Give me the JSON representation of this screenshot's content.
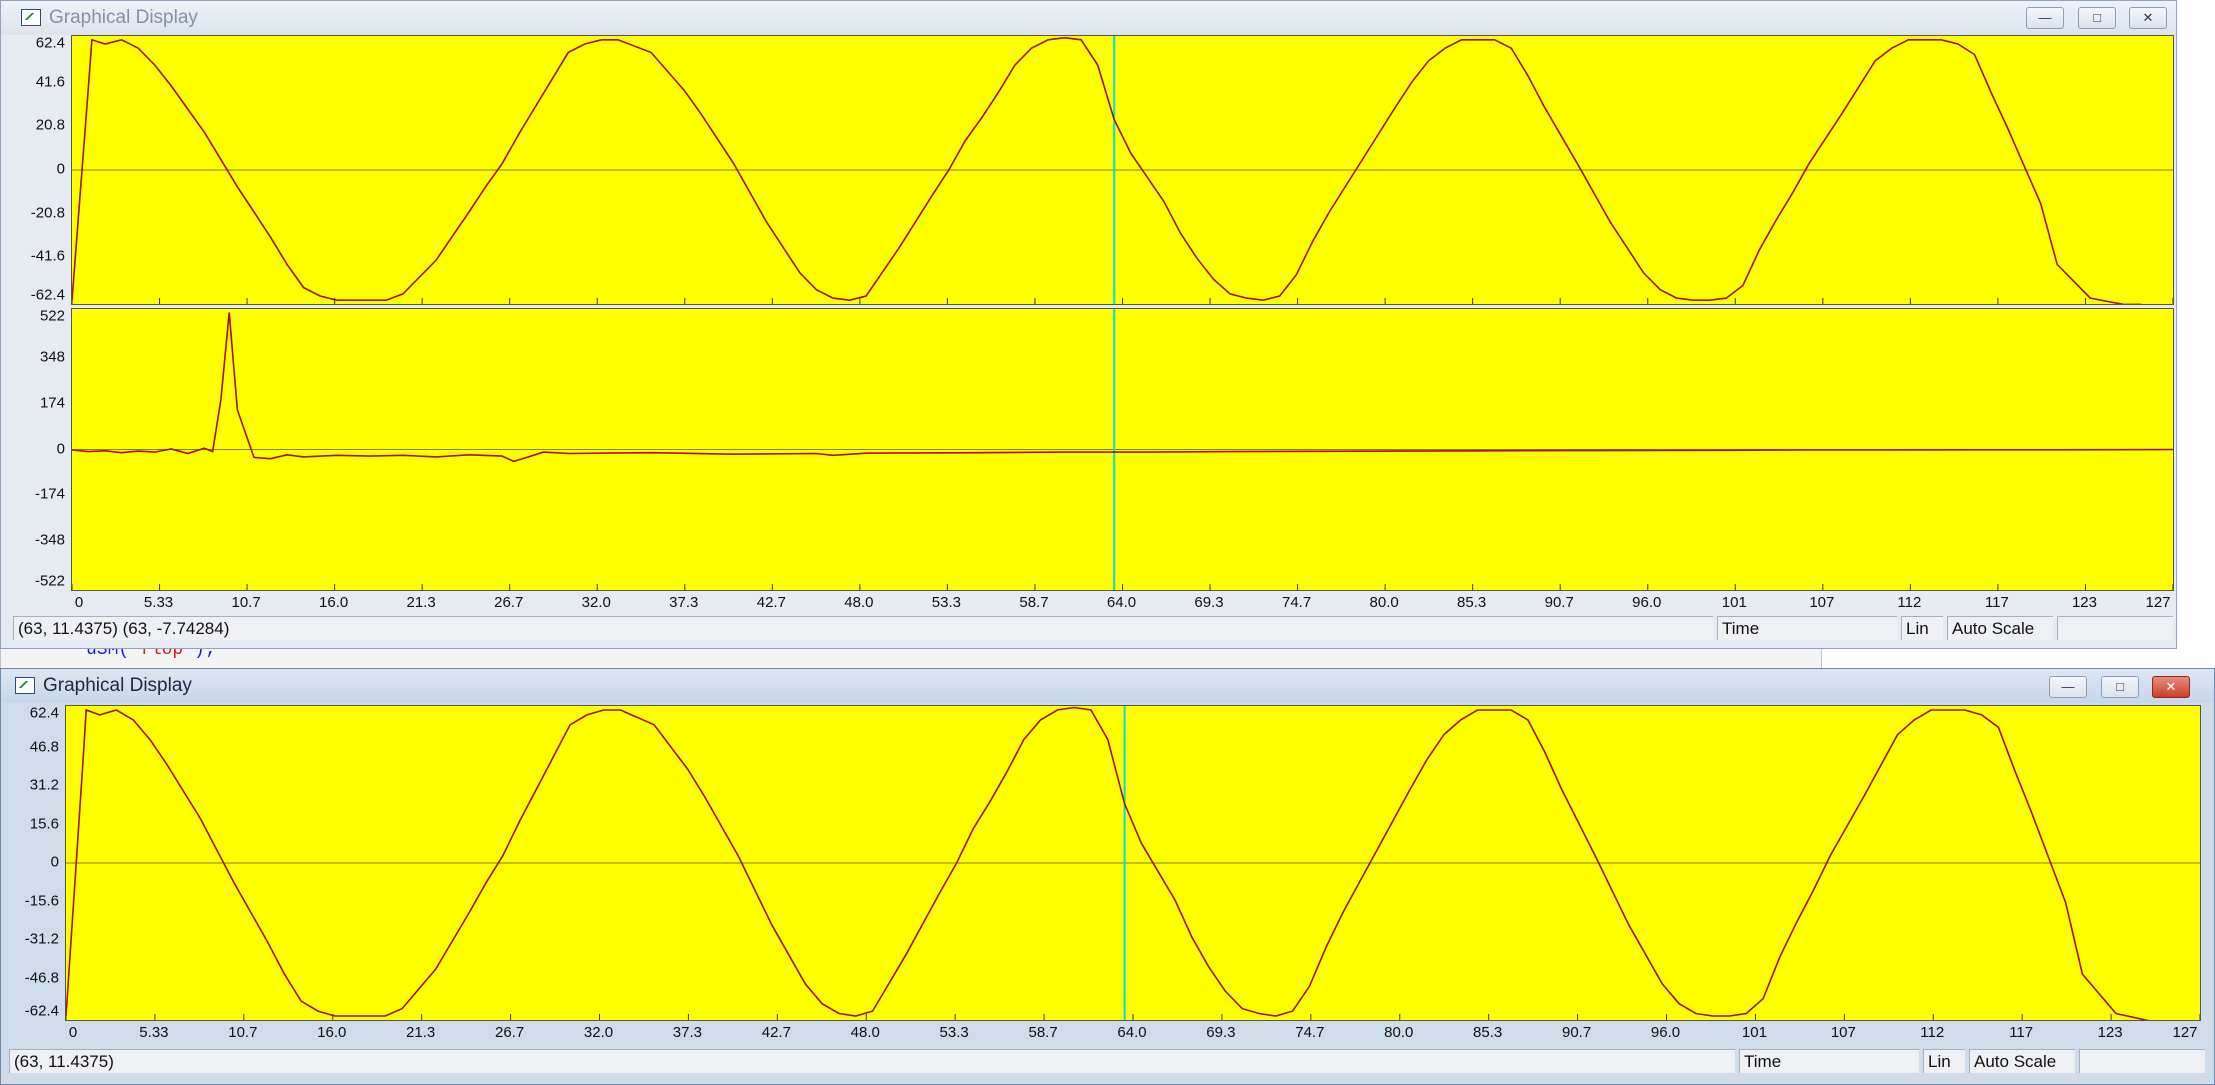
{
  "windows": [
    {
      "title": "Graphical Display",
      "status": {
        "coords": "(63, 11.4375) (63, -7.74284)",
        "xmode": "Time",
        "scale_type": "Lin",
        "scale_mode": "Auto Scale"
      }
    },
    {
      "title": "Graphical Display",
      "status": {
        "coords": "(63, 11.4375)",
        "xmode": "Time",
        "scale_type": "Lin",
        "scale_mode": "Auto Scale"
      }
    }
  ],
  "background_code": {
    "fn": "uSM",
    "open": "(",
    "str": "\"flop\"",
    "close": ");"
  },
  "caption_buttons": {
    "minimize": "minimize",
    "maximize": "maximize",
    "close": "close"
  },
  "colors": {
    "plot_bg": "#ffff00",
    "trace": "#a01010",
    "zero_line": "#808000",
    "cursor": "#00e0e0"
  },
  "chart_data": [
    {
      "type": "line",
      "xlim": [
        0,
        127
      ],
      "ylim": [
        -62.4,
        62.4
      ],
      "xticks": [
        "0",
        "5.33",
        "10.7",
        "16.0",
        "21.3",
        "26.7",
        "32.0",
        "37.3",
        "42.7",
        "48.0",
        "53.3",
        "58.7",
        "64.0",
        "69.3",
        "74.7",
        "80.0",
        "85.3",
        "90.7",
        "96.0",
        "101",
        "107",
        "112",
        "117",
        "123",
        "127"
      ],
      "yticks": [
        "62.4",
        "41.6",
        "20.8",
        "0",
        "-20.8",
        "-41.6",
        "-62.4"
      ],
      "cursor_x": 63,
      "series": [
        {
          "x": [
            0,
            1,
            1.2,
            2,
            3,
            4,
            5,
            6,
            8,
            10,
            11,
            12,
            13,
            14,
            15,
            16,
            17,
            18,
            19,
            20,
            22,
            24,
            25,
            26,
            27,
            28,
            29,
            30,
            31,
            32,
            33,
            35,
            37,
            38,
            39,
            40,
            41,
            42,
            43,
            44,
            45,
            46,
            47,
            48,
            50,
            52,
            53,
            54,
            55,
            56,
            57,
            58,
            59,
            60,
            61,
            62,
            63,
            64,
            66,
            67,
            68,
            69,
            70,
            71,
            72,
            73,
            74,
            75,
            76,
            78,
            80,
            81,
            82,
            83,
            84,
            85,
            86,
            87,
            88,
            89,
            91,
            93,
            94,
            95,
            96,
            97,
            98,
            99,
            100,
            101,
            102,
            103,
            104,
            105,
            107,
            109,
            110,
            111,
            112,
            113,
            114,
            115,
            116,
            117,
            118,
            119,
            120,
            122,
            124,
            125,
            126,
            127
          ],
          "y": [
            -62,
            40,
            62,
            60,
            62,
            58,
            50,
            40,
            18,
            -8,
            -20,
            -32,
            -45,
            -56,
            -60,
            -62,
            -62,
            -62,
            -62,
            -59,
            -43,
            -20,
            -8,
            3,
            17,
            30,
            43,
            56,
            60,
            62,
            62,
            56,
            38,
            27,
            15,
            3,
            -11,
            -25,
            -37,
            -49,
            -57,
            -61,
            -62,
            -60,
            -37,
            -12,
            0,
            14,
            25,
            37,
            50,
            58,
            62,
            63,
            62,
            50,
            24,
            8,
            -15,
            -30,
            -42,
            -52,
            -59,
            -61,
            -62,
            -60,
            -50,
            -34,
            -20,
            5,
            30,
            42,
            52,
            58,
            62,
            62,
            62,
            58,
            45,
            30,
            3,
            -25,
            -37,
            -49,
            -57,
            -61,
            -62,
            -62,
            -61,
            -55,
            -38,
            -24,
            -11,
            3,
            27,
            52,
            58,
            62,
            62,
            62,
            60,
            55,
            37,
            20,
            2,
            -16,
            -45,
            -61,
            -64,
            -64,
            -65,
            -65
          ]
        }
      ]
    },
    {
      "type": "line",
      "xlim": [
        0,
        127
      ],
      "ylim": [
        -522,
        522
      ],
      "xticks": [
        "0",
        "5.33",
        "10.7",
        "16.0",
        "21.3",
        "26.7",
        "32.0",
        "37.3",
        "42.7",
        "48.0",
        "53.3",
        "58.7",
        "64.0",
        "69.3",
        "74.7",
        "80.0",
        "85.3",
        "90.7",
        "96.0",
        "101",
        "107",
        "112",
        "117",
        "123",
        "127"
      ],
      "yticks": [
        "522",
        "348",
        "174",
        "0",
        "-174",
        "-348",
        "-522"
      ],
      "cursor_x": 63,
      "series": [
        {
          "x": [
            0,
            1,
            2,
            3,
            4,
            5,
            6,
            7,
            8,
            8.5,
            9,
            9.5,
            10,
            11,
            12,
            13,
            14,
            16,
            18,
            20,
            22,
            24,
            26,
            26.7,
            27.5,
            28.5,
            30,
            35,
            40,
            45,
            46,
            48,
            55,
            60,
            65,
            70,
            80,
            85,
            90,
            100,
            105,
            110,
            115,
            120,
            127
          ],
          "y": [
            -2,
            -8,
            -5,
            -12,
            -6,
            -10,
            2,
            -15,
            5,
            -8,
            190,
            520,
            150,
            -30,
            -35,
            -20,
            -28,
            -22,
            -25,
            -22,
            -28,
            -20,
            -25,
            -45,
            -30,
            -10,
            -15,
            -12,
            -18,
            -15,
            -22,
            -14,
            -12,
            -10,
            -10,
            -8,
            -6,
            -5,
            -4,
            -3,
            -2,
            -2,
            -1,
            -1,
            0
          ]
        }
      ]
    },
    {
      "type": "line",
      "xlim": [
        0,
        127
      ],
      "ylim": [
        -62.4,
        62.4
      ],
      "xticks": [
        "0",
        "5.33",
        "10.7",
        "16.0",
        "21.3",
        "26.7",
        "32.0",
        "37.3",
        "42.7",
        "48.0",
        "53.3",
        "58.7",
        "64.0",
        "69.3",
        "74.7",
        "80.0",
        "85.3",
        "90.7",
        "96.0",
        "101",
        "107",
        "112",
        "117",
        "123",
        "127"
      ],
      "yticks": [
        "62.4",
        "46.8",
        "31.2",
        "15.6",
        "0",
        "-15.6",
        "-31.2",
        "-46.8",
        "-62.4"
      ],
      "cursor_x": 63,
      "series": [
        {
          "x": [
            0,
            1,
            1.2,
            2,
            3,
            4,
            5,
            6,
            8,
            10,
            11,
            12,
            13,
            14,
            15,
            16,
            17,
            18,
            19,
            20,
            22,
            24,
            25,
            26,
            27,
            28,
            29,
            30,
            31,
            32,
            33,
            35,
            37,
            38,
            39,
            40,
            41,
            42,
            43,
            44,
            45,
            46,
            47,
            48,
            50,
            52,
            53,
            54,
            55,
            56,
            57,
            58,
            59,
            60,
            61,
            62,
            63,
            64,
            66,
            67,
            68,
            69,
            70,
            71,
            72,
            73,
            74,
            75,
            76,
            78,
            80,
            81,
            82,
            83,
            84,
            85,
            86,
            87,
            88,
            89,
            91,
            93,
            94,
            95,
            96,
            97,
            98,
            99,
            100,
            101,
            102,
            103,
            104,
            105,
            107,
            109,
            110,
            111,
            112,
            113,
            114,
            115,
            116,
            117,
            118,
            119,
            120,
            122,
            124,
            125,
            126,
            127
          ],
          "y": [
            -62,
            40,
            62,
            60,
            62,
            58,
            50,
            40,
            18,
            -8,
            -20,
            -32,
            -45,
            -56,
            -60,
            -62,
            -62,
            -62,
            -62,
            -59,
            -43,
            -20,
            -8,
            3,
            17,
            30,
            43,
            56,
            60,
            62,
            62,
            56,
            38,
            27,
            15,
            3,
            -11,
            -25,
            -37,
            -49,
            -57,
            -61,
            -62,
            -60,
            -37,
            -12,
            0,
            14,
            25,
            37,
            50,
            58,
            62,
            63,
            62,
            50,
            24,
            8,
            -15,
            -30,
            -42,
            -52,
            -59,
            -61,
            -62,
            -60,
            -50,
            -34,
            -20,
            5,
            30,
            42,
            52,
            58,
            62,
            62,
            62,
            58,
            45,
            30,
            3,
            -25,
            -37,
            -49,
            -57,
            -61,
            -62,
            -62,
            -61,
            -55,
            -38,
            -24,
            -11,
            3,
            27,
            52,
            58,
            62,
            62,
            62,
            60,
            55,
            37,
            20,
            2,
            -16,
            -45,
            -61,
            -64,
            -64,
            -65,
            -65
          ]
        }
      ]
    }
  ]
}
